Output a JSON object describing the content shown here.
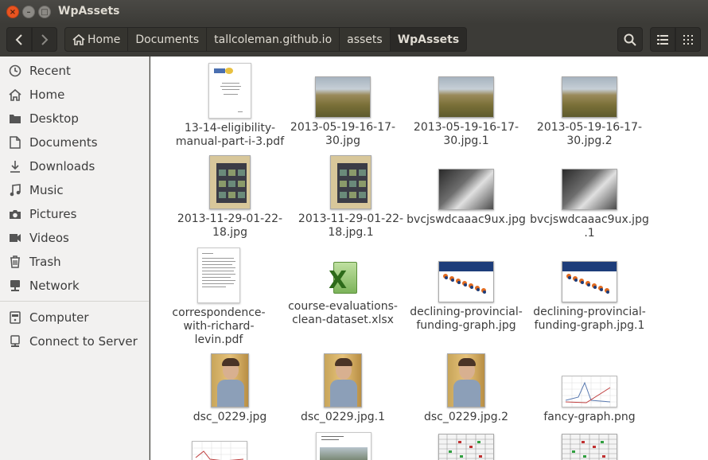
{
  "window": {
    "title": "WpAssets",
    "close": "×",
    "minimize": "–",
    "maximize": "□"
  },
  "breadcrumbs": [
    "Home",
    "Documents",
    "tallcoleman.github.io",
    "assets",
    "WpAssets"
  ],
  "sidebar": {
    "items": [
      {
        "label": "Recent",
        "icon": "clock-icon"
      },
      {
        "label": "Home",
        "icon": "home-icon"
      },
      {
        "label": "Desktop",
        "icon": "folder-icon"
      },
      {
        "label": "Documents",
        "icon": "document-icon"
      },
      {
        "label": "Downloads",
        "icon": "download-icon"
      },
      {
        "label": "Music",
        "icon": "music-icon"
      },
      {
        "label": "Pictures",
        "icon": "camera-icon"
      },
      {
        "label": "Videos",
        "icon": "video-icon"
      },
      {
        "label": "Trash",
        "icon": "trash-icon"
      },
      {
        "label": "Network",
        "icon": "network-icon"
      },
      {
        "label": "Computer",
        "icon": "computer-icon"
      },
      {
        "label": "Connect to Server",
        "icon": "server-icon"
      }
    ]
  },
  "files": [
    {
      "name": "13-14-eligibility-manual-part-i-3.pdf",
      "kind": "pdf"
    },
    {
      "name": "2013-05-19-16-17-30.jpg",
      "kind": "landscape"
    },
    {
      "name": "2013-05-19-16-17-30.jpg.1",
      "kind": "landscape"
    },
    {
      "name": "2013-05-19-16-17-30.jpg.2",
      "kind": "landscape"
    },
    {
      "name": "2013-11-29-01-22-18.jpg",
      "kind": "poster"
    },
    {
      "name": "2013-11-29-01-22-18.jpg.1",
      "kind": "poster"
    },
    {
      "name": "bvcjswdcaaac9ux.jpg",
      "kind": "note"
    },
    {
      "name": "bvcjswdcaaac9ux.jpg.1",
      "kind": "note"
    },
    {
      "name": "correspondence-with-richard-levin.pdf",
      "kind": "letter"
    },
    {
      "name": "course-evaluations-clean-dataset.xlsx",
      "kind": "xlsx"
    },
    {
      "name": "declining-provincial-funding-graph.jpg",
      "kind": "chart"
    },
    {
      "name": "declining-provincial-funding-graph.jpg.1",
      "kind": "chart"
    },
    {
      "name": "dsc_0229.jpg",
      "kind": "portrait"
    },
    {
      "name": "dsc_0229.jpg.1",
      "kind": "portrait"
    },
    {
      "name": "dsc_0229.jpg.2",
      "kind": "portrait"
    },
    {
      "name": "fancy-graph.png",
      "kind": "graph"
    }
  ],
  "partial_row": [
    {
      "kind": "graph2"
    },
    {
      "kind": "brochure"
    },
    {
      "kind": "sheet"
    },
    {
      "kind": "sheet"
    }
  ]
}
